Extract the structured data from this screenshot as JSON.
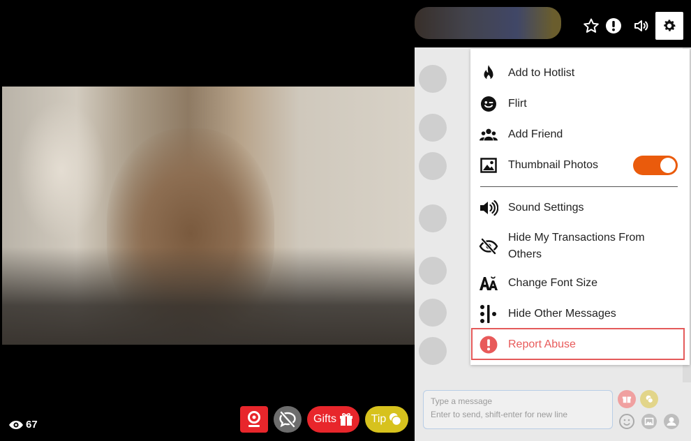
{
  "stream": {
    "viewer_count": "67"
  },
  "header": {
    "favorite_icon": "star-icon",
    "alert_icon": "exclamation-circle-icon",
    "volume_icon": "volume-icon",
    "settings_icon": "gear-icon"
  },
  "menu": {
    "items": [
      {
        "label": "Add to Hotlist",
        "icon": "flame-icon"
      },
      {
        "label": "Flirt",
        "icon": "wink-face-icon"
      },
      {
        "label": "Add Friend",
        "icon": "people-icon"
      },
      {
        "label": "Thumbnail Photos",
        "icon": "image-icon",
        "toggle_on": true
      },
      {
        "label": "Sound Settings",
        "icon": "speaker-icon"
      },
      {
        "label": "Hide My Transactions From Others",
        "icon": "eye-slash-icon"
      },
      {
        "label": "Change Font Size",
        "icon": "font-size-icon"
      },
      {
        "label": "Hide Other Messages",
        "icon": "dots-bar-icon"
      },
      {
        "label": "Report Abuse",
        "icon": "exclamation-circle-icon",
        "color": "#e85a5a"
      }
    ]
  },
  "chat": {
    "input_placeholder": "Type a message\nEnter to send, shift-enter for new line"
  },
  "bottom_bar": {
    "gifts_label": "Gifts",
    "tip_label": "Tip"
  },
  "colors": {
    "accent_orange": "#ea5b0c",
    "report_red": "#e85a5a",
    "webcam_red": "#e8262b",
    "gifts_red": "#e8262b",
    "tip_yellow": "#d7c21d",
    "mute_gray": "#6d6d6d"
  }
}
